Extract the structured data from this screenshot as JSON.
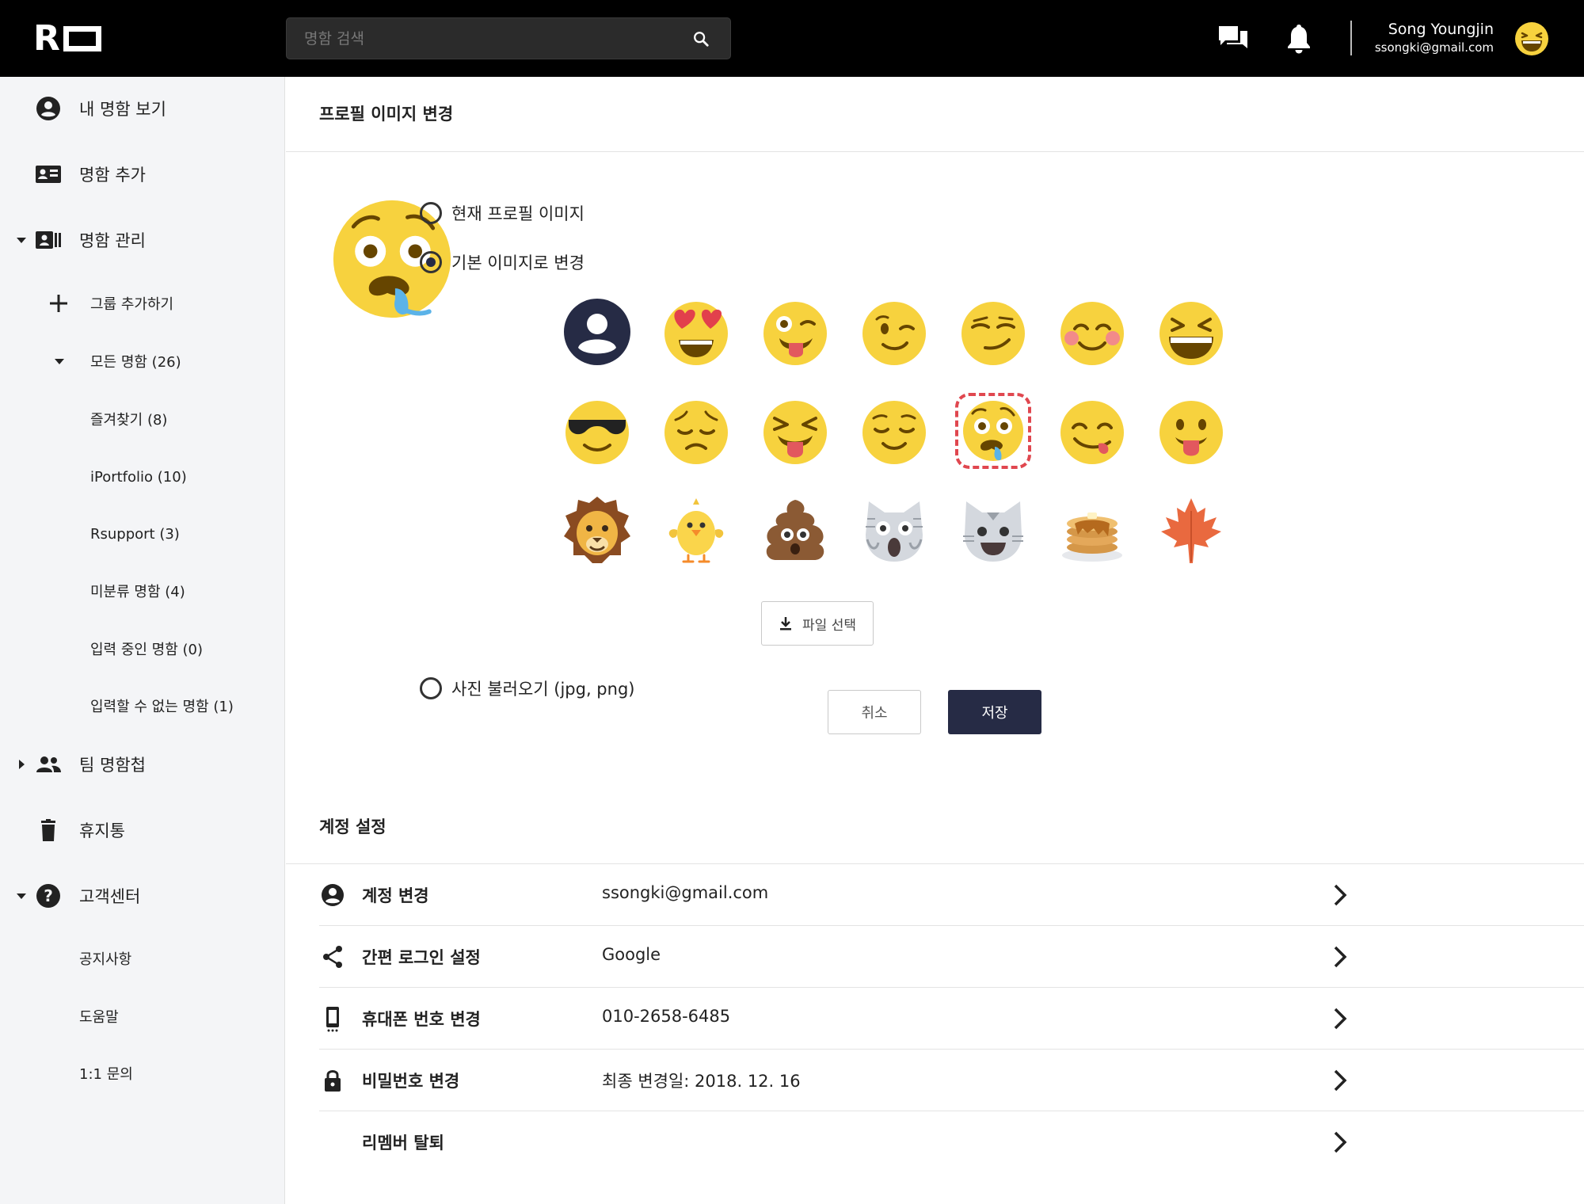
{
  "header": {
    "search_placeholder": "명함 검색",
    "user_name": "Song Youngjin",
    "user_email": "ssongki@gmail.com",
    "tooltip": "알림"
  },
  "sidebar": {
    "items": [
      {
        "label": "내 명함 보기",
        "icon": "account-circle-icon"
      },
      {
        "label": "명함 추가",
        "icon": "contact-card-icon"
      },
      {
        "label": "명함 관리",
        "icon": "card-manage-icon",
        "expanded": true
      },
      {
        "label": "그룹 추가하기",
        "icon": "plus-icon"
      },
      {
        "label": "모든 명함 (26)",
        "expanded": true
      },
      {
        "label": "즐겨찾기 (8)"
      },
      {
        "label": "iPortfolio (10)"
      },
      {
        "label": "Rsupport (3)"
      },
      {
        "label": "미분류 명함 (4)"
      },
      {
        "label": "입력 중인 명함 (0)"
      },
      {
        "label": "입력할 수 없는 명함 (1)"
      },
      {
        "label": "팀 명함첩",
        "icon": "people-icon",
        "expanded": false
      },
      {
        "label": "휴지통",
        "icon": "trash-icon"
      },
      {
        "label": "고객센터",
        "icon": "help-icon",
        "expanded": true
      },
      {
        "label": "공지사항"
      },
      {
        "label": "도움말"
      },
      {
        "label": "1:1 문의"
      }
    ]
  },
  "profile": {
    "title": "프로필 이미지 변경",
    "option_current": "현재 프로필 이미지",
    "option_default": "기본 이미지로 변경",
    "option_upload": "사진 불러오기 (jpg, png)",
    "file_button": "파일 선택",
    "cancel": "취소",
    "save": "저장",
    "selected_option": "default",
    "selected_emoji": "drooling-face",
    "emojis": [
      "default-person",
      "heart-eyes",
      "winking-tongue",
      "winking",
      "smirking",
      "smiling-blush",
      "grinning-squint",
      "sunglasses",
      "pensive",
      "squinting-tongue",
      "relieved",
      "drooling-face",
      "yum",
      "tongue-out",
      "lion",
      "chick",
      "poop",
      "screaming-cat",
      "cat-smile",
      "pancakes",
      "maple-leaf"
    ]
  },
  "account": {
    "title": "계정 설정",
    "rows": [
      {
        "label": "계정 변경",
        "value": "ssongki@gmail.com",
        "icon": "account-circle-icon"
      },
      {
        "label": "간편 로그인 설정",
        "value": "Google",
        "icon": "share-icon"
      },
      {
        "label": "휴대폰 번호 변경",
        "value": "010-2658-6485",
        "icon": "phone-icon"
      },
      {
        "label": "비밀번호 변경",
        "value": "최종 변경일: 2018. 12. 16",
        "icon": "lock-icon"
      },
      {
        "label": "리멤버 탈퇴",
        "value": "",
        "icon": ""
      }
    ]
  }
}
